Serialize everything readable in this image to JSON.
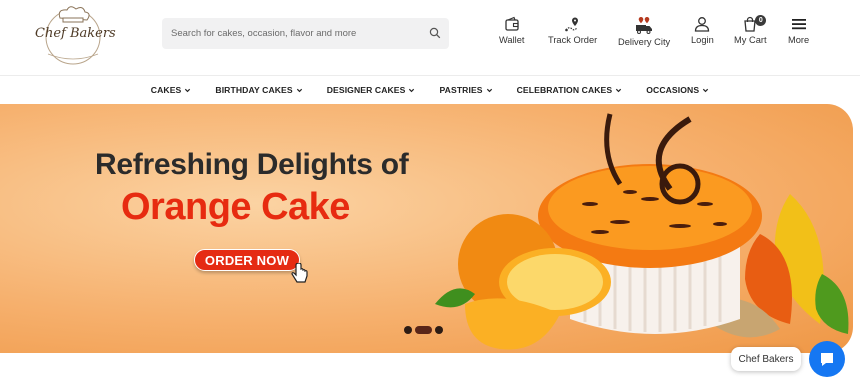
{
  "brand": {
    "logo_text": "Chef Bakers",
    "logo_icon": "chef-hat-icon"
  },
  "search": {
    "placeholder": "Search for cakes, occasion, flavor and more",
    "icon": "search-icon"
  },
  "header_nav": [
    {
      "label": "Wallet",
      "icon": "wallet-icon"
    },
    {
      "label": "Track Order",
      "icon": "track-order-icon"
    },
    {
      "label": "Delivery City",
      "icon": "delivery-truck-icon"
    },
    {
      "label": "Login",
      "icon": "user-icon"
    },
    {
      "label": "My Cart",
      "icon": "cart-icon",
      "badge": "0"
    },
    {
      "label": "More",
      "icon": "menu-icon"
    }
  ],
  "menu": [
    {
      "label": "CAKES"
    },
    {
      "label": "BIRTHDAY CAKES"
    },
    {
      "label": "DESIGNER CAKES"
    },
    {
      "label": "PASTRIES"
    },
    {
      "label": "CELEBRATION CAKES"
    },
    {
      "label": "OCCASIONS"
    }
  ],
  "banner": {
    "headline_line1": "Refreshing Delights of",
    "headline_line2": "Orange Cake",
    "cta_label": "ORDER NOW",
    "slides_total": 3,
    "active_slide": 2
  },
  "chat": {
    "label": "Chef Bakers",
    "icon": "chat-bubble-icon"
  },
  "colors": {
    "accent": "#e52b13",
    "chat": "#1577f2",
    "banner_bg": "#f6b06d"
  }
}
